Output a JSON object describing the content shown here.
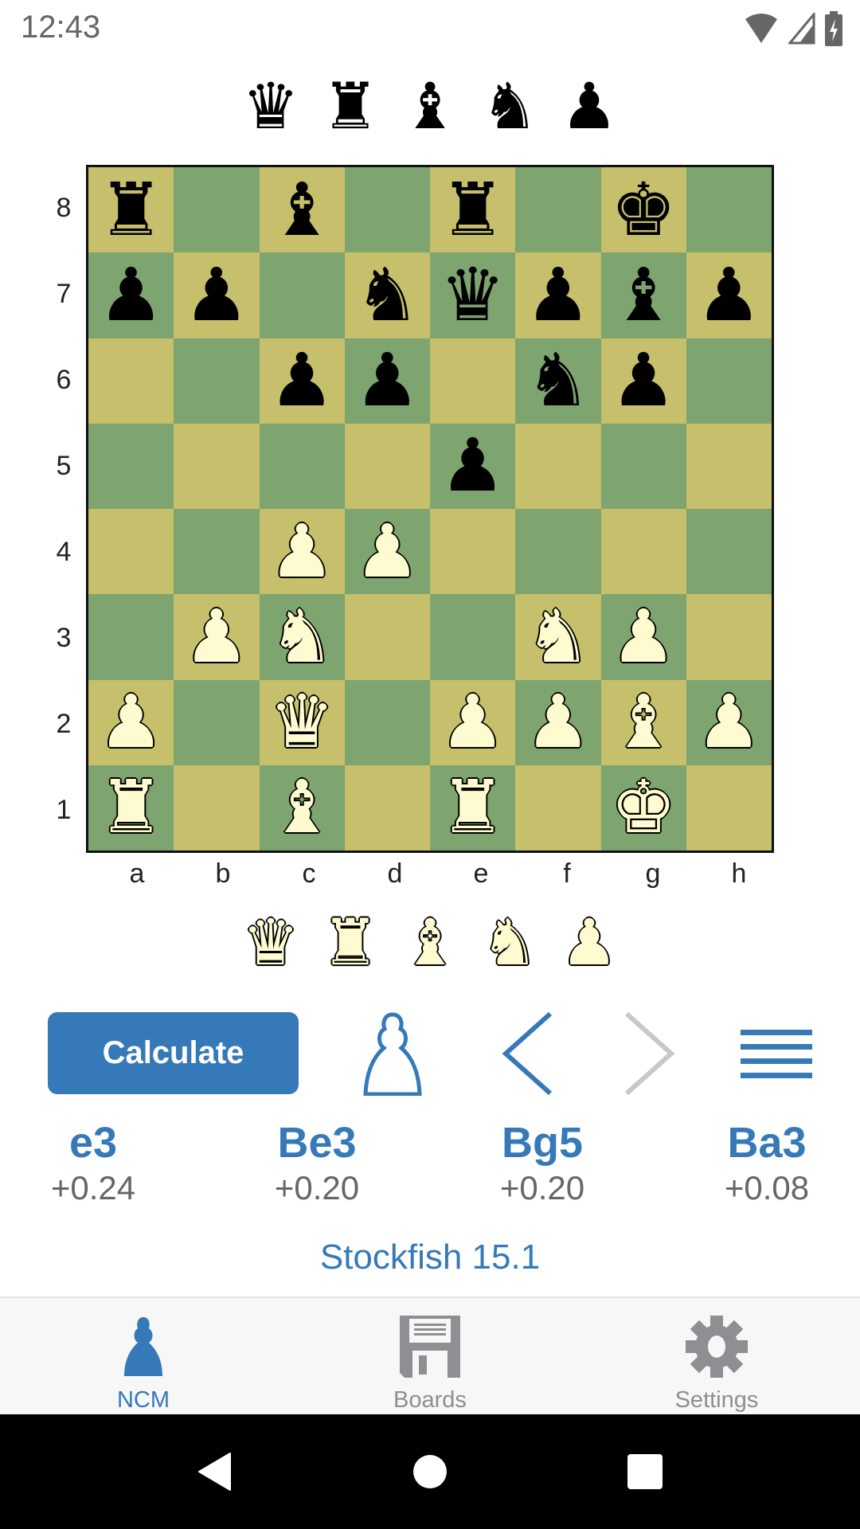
{
  "status_bar": {
    "time": "12:43",
    "icons": [
      "wifi-icon",
      "cell-signal-icon",
      "battery-charging-icon"
    ]
  },
  "captured_top": [
    {
      "piece": "queen",
      "color": "black",
      "glyph": "♛"
    },
    {
      "piece": "rook",
      "color": "black",
      "glyph": "♜"
    },
    {
      "piece": "bishop",
      "color": "black",
      "glyph": "♝"
    },
    {
      "piece": "knight",
      "color": "black",
      "glyph": "♞"
    },
    {
      "piece": "pawn",
      "color": "black",
      "glyph": "♟"
    }
  ],
  "captured_bottom": [
    {
      "piece": "queen",
      "color": "white",
      "glyph": "♛"
    },
    {
      "piece": "rook",
      "color": "white",
      "glyph": "♜"
    },
    {
      "piece": "bishop",
      "color": "white",
      "glyph": "♝"
    },
    {
      "piece": "knight",
      "color": "white",
      "glyph": "♞"
    },
    {
      "piece": "pawn",
      "color": "white",
      "glyph": "♟"
    }
  ],
  "board": {
    "fen": "r1b1r1k1/pp1nqpbp/2pp1np1/4p3/2PP4/1PN2NP1/P1Q1PPBP/R1B1R1K1",
    "ranks": [
      "8",
      "7",
      "6",
      "5",
      "4",
      "3",
      "2",
      "1"
    ],
    "files": [
      "a",
      "b",
      "c",
      "d",
      "e",
      "f",
      "g",
      "h"
    ],
    "colors": {
      "light": "#C6BF6B",
      "dark": "#7EA46F"
    }
  },
  "controls": {
    "calculate_label": "Calculate",
    "side_to_move_icon": "pawn-outline-icon",
    "back_icon": "chevron-left-icon",
    "forward_icon": "chevron-right-icon",
    "menu_icon": "hamburger-menu-icon",
    "forward_enabled": false
  },
  "moves": [
    {
      "san": "e3",
      "eval": "+0.24"
    },
    {
      "san": "Be3",
      "eval": "+0.20"
    },
    {
      "san": "Bg5",
      "eval": "+0.20"
    },
    {
      "san": "Ba3",
      "eval": "+0.08"
    }
  ],
  "engine_name": "Stockfish 15.1",
  "tabs": [
    {
      "label": "NCM",
      "icon": "pawn-icon",
      "active": true
    },
    {
      "label": "Boards",
      "icon": "floppy-disk-icon",
      "active": false
    },
    {
      "label": "Settings",
      "icon": "gear-icon",
      "active": false
    }
  ],
  "colors": {
    "accent": "#3679B9",
    "inactive": "#8E8E93",
    "eval_text": "#666666"
  }
}
